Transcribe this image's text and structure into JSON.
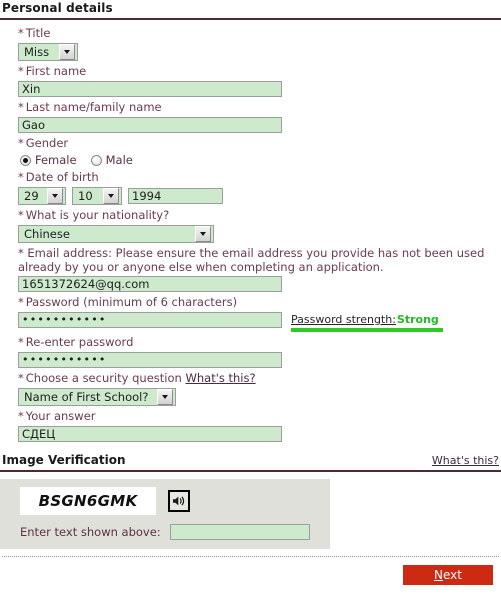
{
  "personal": {
    "heading": "Personal details",
    "title": {
      "label": "Title",
      "required_mark": "*",
      "value": "Miss"
    },
    "first_name": {
      "label": "First name",
      "required_mark": "*",
      "value": "Xin"
    },
    "last_name": {
      "label": "Last name/family name",
      "required_mark": "*",
      "value": "Gao"
    },
    "gender": {
      "label": "Gender",
      "required_mark": "*",
      "options": [
        "Female",
        "Male"
      ],
      "female_label": "Female",
      "male_label": "Male",
      "selected": "Female"
    },
    "dob": {
      "label": "Date of birth",
      "required_mark": "*",
      "day": "29",
      "month": "10",
      "year": "1994"
    },
    "nationality": {
      "label": "What is your nationality?",
      "required_mark": "*",
      "value": "Chinese"
    },
    "email": {
      "label": "* Email address: Please ensure the email address you provide has not been used already by you or anyone else when completing an application.",
      "value": "1651372624@qq.com"
    },
    "password": {
      "label": "Password (minimum of 6 characters)",
      "required_mark": "*",
      "value": "***********",
      "strength_caption": "Password strength:",
      "strength_value": "Strong",
      "strength_color": "#22bb22"
    },
    "reenter_password": {
      "label": "Re-enter password",
      "required_mark": "*",
      "value": "***********"
    },
    "security_question": {
      "label": "Choose a security question",
      "required_mark": "*",
      "help_link": "What's this?",
      "value": "Name of First School?"
    },
    "answer": {
      "label": "Your answer",
      "required_mark": "*",
      "value": "СДЕЦ"
    }
  },
  "image_verification": {
    "heading": "Image Verification",
    "help_link": "What's this?",
    "captcha_text": "BSGN6GMK",
    "audio_icon": "speaker-icon",
    "entry_label": "Enter text shown above:",
    "entry_value": ""
  },
  "footer": {
    "next_accesskey": "N",
    "next_rest": "ext",
    "next_label": "Next",
    "next_color": "#cc2a12"
  }
}
